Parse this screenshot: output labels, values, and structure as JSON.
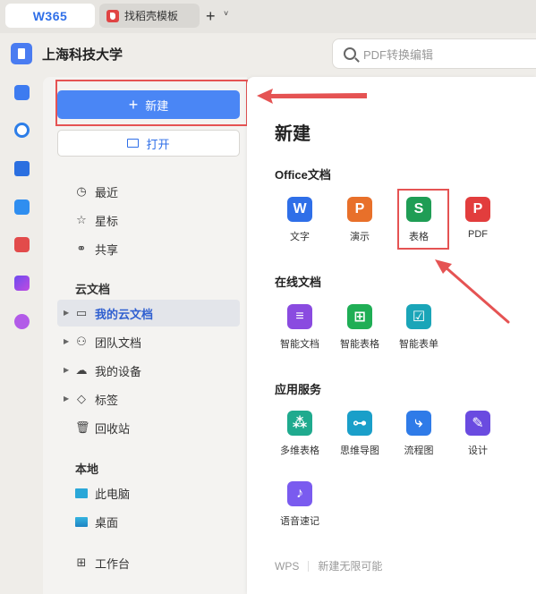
{
  "tabs": {
    "home": "W365",
    "doc": "找稻壳模板",
    "add": "+",
    "more": "˅"
  },
  "org_name": "上海科技大学",
  "search": {
    "placeholder": "PDF转换编辑"
  },
  "sidebar": {
    "new_button": "新建",
    "open_button": "打开",
    "quick": [
      {
        "label": "最近",
        "icon": "clock-icon"
      },
      {
        "label": "星标",
        "icon": "star-icon"
      },
      {
        "label": "共享",
        "icon": "share-icon"
      }
    ],
    "cloud_section": "云文档",
    "cloud": [
      {
        "label": "我的云文档",
        "icon": "folder-icon",
        "selected": true
      },
      {
        "label": "团队文档",
        "icon": "team-icon"
      },
      {
        "label": "我的设备",
        "icon": "cloud-device-icon"
      },
      {
        "label": "标签",
        "icon": "tag-icon"
      },
      {
        "label": "回收站",
        "icon": "trash-icon"
      }
    ],
    "local_section": "本地",
    "local": [
      {
        "label": "此电脑",
        "icon": "computer-icon"
      },
      {
        "label": "桌面",
        "icon": "desktop-icon"
      }
    ],
    "workbench": "工作台"
  },
  "main": {
    "title": "新建",
    "office_title": "Office文档",
    "office_apps": [
      {
        "label": "文字",
        "glyph": "W",
        "color": "#2f6fe8"
      },
      {
        "label": "演示",
        "glyph": "P",
        "color": "#e8702a"
      },
      {
        "label": "表格",
        "glyph": "S",
        "color": "#1f9d55"
      },
      {
        "label": "PDF",
        "glyph": "P",
        "color": "#e23d3d"
      }
    ],
    "online_title": "在线文档",
    "online_apps": [
      {
        "label": "智能文档",
        "color": "#8a4be0"
      },
      {
        "label": "智能表格",
        "color": "#1fae55"
      },
      {
        "label": "智能表单",
        "color": "#1aa5b8"
      }
    ],
    "service_title": "应用服务",
    "service_apps": [
      {
        "label": "多维表格",
        "color": "#1faa8e"
      },
      {
        "label": "思维导图",
        "color": "#1a9fc9"
      },
      {
        "label": "流程图",
        "color": "#2f7be8"
      },
      {
        "label": "设计",
        "color": "#6a4be0"
      },
      {
        "label": "语音速记",
        "color": "#7a5bef"
      }
    ],
    "footer_brand": "WPS",
    "footer_slogan": "新建无限可能"
  },
  "colors": {
    "accent": "#4a86f5",
    "highlight_border": "#e55353",
    "selected_text": "#2f5fd0"
  }
}
